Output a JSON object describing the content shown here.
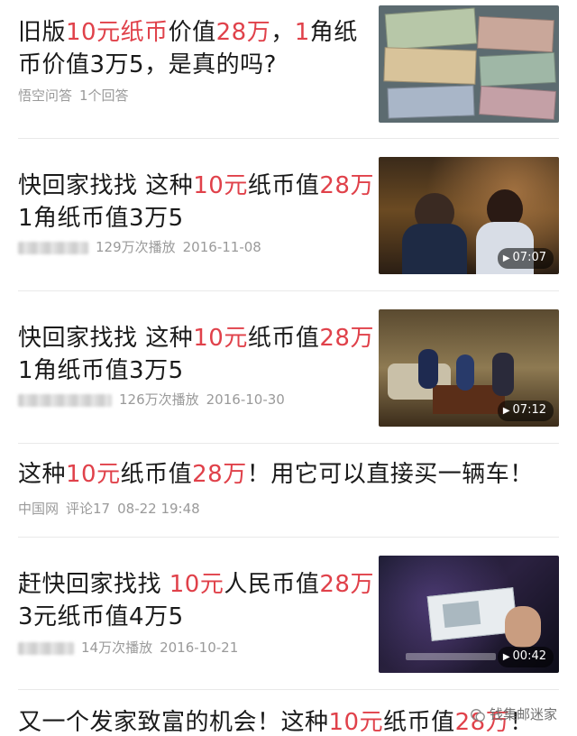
{
  "feed": [
    {
      "title_parts": [
        "旧版",
        "10元纸币",
        "价值",
        "28万",
        "，",
        "1",
        "角纸币价值3万5，是真的吗?"
      ],
      "meta": {
        "source": "悟空问答",
        "stat": "1个回答"
      }
    },
    {
      "title_parts": [
        "快回家找找 这种",
        "10元",
        "纸币值",
        "28万",
        " 1角纸币值3万5"
      ],
      "meta": {
        "stat": "129万次播放",
        "date": "2016-11-08"
      },
      "duration": "07:07"
    },
    {
      "title_parts": [
        "快回家找找 这种",
        "10元",
        "纸币值",
        "28万",
        " 1角纸币值3万5"
      ],
      "meta": {
        "stat": "126万次播放",
        "date": "2016-10-30"
      },
      "duration": "07:12"
    },
    {
      "title_parts": [
        "这种",
        "10元",
        "纸币值",
        "28万",
        "！用它可以直接买一辆车！"
      ],
      "meta": {
        "source": "中国网",
        "stat": "评论17",
        "date": "08-22 19:48"
      }
    },
    {
      "title_parts": [
        "赶快回家找找 ",
        "10元",
        "人民币值",
        "28万",
        " 3元纸币值4万5"
      ],
      "meta": {
        "stat": "14万次播放",
        "date": "2016-10-21"
      },
      "duration": "00:42"
    },
    {
      "title_parts": [
        "又一个发家致富的机会！这种",
        "10元",
        "纸币值",
        "28万",
        "！"
      ]
    }
  ],
  "watermark": "钱集邮迷家",
  "colors": {
    "highlight": "#e0414a",
    "meta": "#9a9a9a"
  }
}
